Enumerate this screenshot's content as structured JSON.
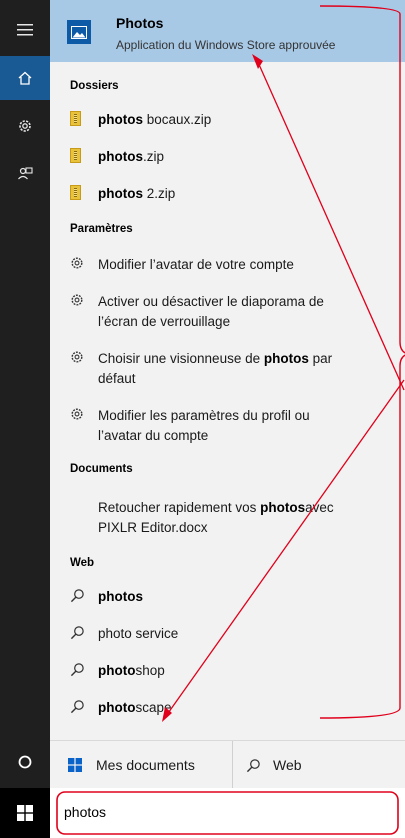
{
  "best_match": {
    "title": "Photos",
    "subtitle": "Application du Windows Store approuvée"
  },
  "sections": {
    "folders": "Dossiers",
    "settings": "Paramètres",
    "documents": "Documents",
    "web": "Web"
  },
  "folders": [
    {
      "bold": "photos",
      "rest": " bocaux.zip"
    },
    {
      "bold": "photos",
      "rest": ".zip"
    },
    {
      "bold": "photos",
      "rest": " 2.zip"
    }
  ],
  "settings": [
    {
      "line1": "Modifier l’avatar de votre compte"
    },
    {
      "line1": "Activer ou désactiver le diaporama de",
      "line2": "l’écran de verrouillage"
    },
    {
      "line1_pre": "Choisir une visionneuse de ",
      "line1_bold": "photos",
      "line1_post": " par",
      "line2": "défaut"
    },
    {
      "line1": "Modifier les paramètres du profil ou",
      "line2": "l’avatar du compte"
    }
  ],
  "document": {
    "pre": "Retoucher rapidement vos ",
    "bold": "photos",
    "post": "avec",
    "line2": "PIXLR Editor.docx"
  },
  "web": [
    {
      "bold": "photos",
      "rest": ""
    },
    {
      "bold": "",
      "rest": "photo service"
    },
    {
      "bold": "photo",
      "rest": "shop"
    },
    {
      "bold": "photo",
      "rest": "scape"
    }
  ],
  "bottom_bar": {
    "my_docs": "Mes documents",
    "web": "Web"
  },
  "search": {
    "value": "photos"
  },
  "colors": {
    "rail": "#1f1f1f",
    "rail_active": "#1a5a94",
    "best_match_bg": "#a8c9e6",
    "panel_bg": "#f2f2f2",
    "annotation_red": "#e0001b"
  },
  "icons": {
    "rail": [
      "hamburger-icon",
      "home-icon",
      "gear-icon",
      "feedback-icon",
      "cortana-circle-icon",
      "windows-logo-icon"
    ],
    "folder_items": "zip-file-icon",
    "settings_items": "gear-icon",
    "web_items": "search-icon"
  }
}
